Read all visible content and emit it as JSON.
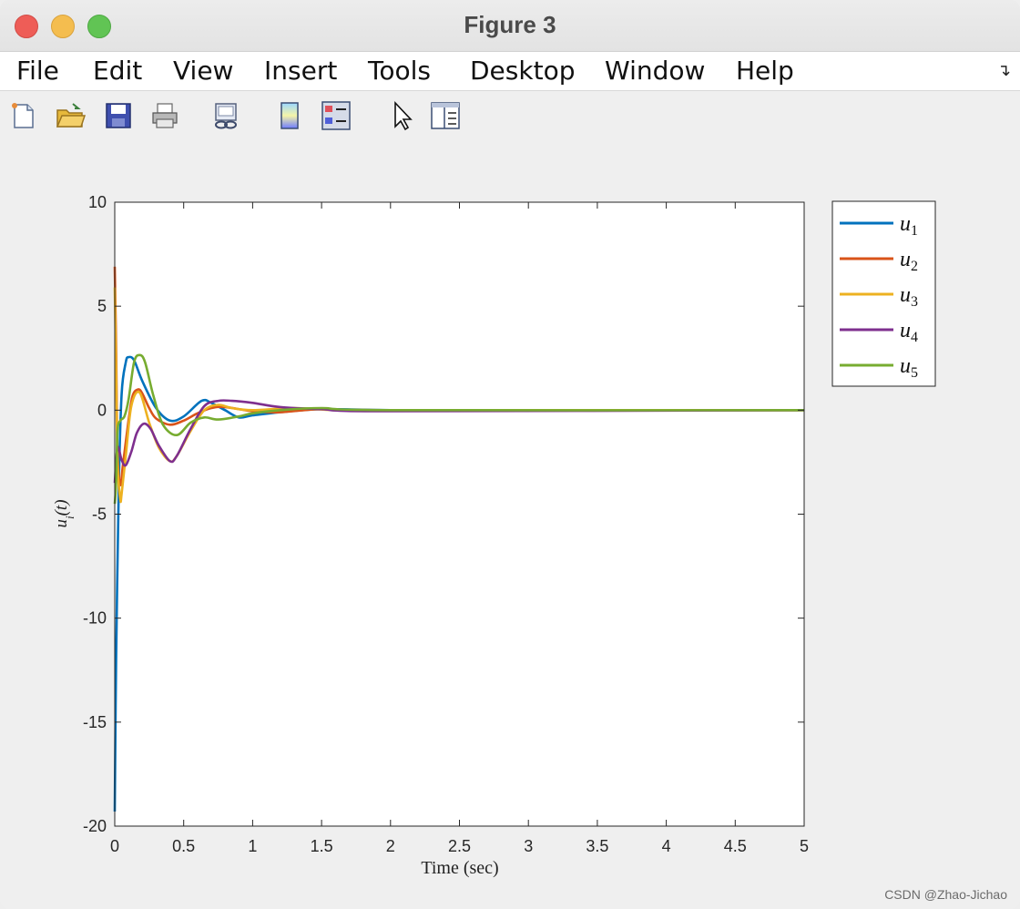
{
  "window": {
    "title": "Figure 3"
  },
  "menu": [
    "File",
    "Edit",
    "View",
    "Insert",
    "Tools",
    "Desktop",
    "Window",
    "Help"
  ],
  "toolbar_icons": [
    "new-figure-icon",
    "open-file-icon",
    "save-icon",
    "print-icon",
    "link-figure-icon",
    "colorbar-icon",
    "legend-icon",
    "pointer-icon",
    "property-inspector-icon"
  ],
  "watermark": "CSDN @Zhao-Jichao",
  "chart_data": {
    "type": "line",
    "title": "",
    "xlabel": "Time (sec)",
    "ylabel": "u_i(t)",
    "xlim": [
      0,
      5
    ],
    "ylim": [
      -20,
      10
    ],
    "xticks": [
      "0",
      "0.5",
      "1",
      "1.5",
      "2",
      "2.5",
      "3",
      "3.5",
      "4",
      "4.5",
      "5"
    ],
    "yticks": [
      "10",
      "5",
      "0",
      "-5",
      "-10",
      "-15",
      "-20"
    ],
    "xtick_values": [
      0,
      0.5,
      1,
      1.5,
      2,
      2.5,
      3,
      3.5,
      4,
      4.5,
      5
    ],
    "ytick_values": [
      10,
      5,
      0,
      -5,
      -10,
      -15,
      -20
    ],
    "grid": false,
    "legend_position": "outside-right-top",
    "series": [
      {
        "name": "u1",
        "color": "#0072BD",
        "x": [
          0,
          0.01,
          0.03,
          0.05,
          0.08,
          0.1,
          0.14,
          0.2,
          0.3,
          0.4,
          0.5,
          0.63,
          0.7,
          0.8,
          0.9,
          1.0,
          1.2,
          1.5,
          2.0,
          3.0,
          5.0
        ],
        "y": [
          -19.3,
          -12,
          -3.5,
          0.8,
          2.3,
          2.55,
          2.4,
          1.4,
          0.1,
          -0.5,
          -0.3,
          0.45,
          0.35,
          0.0,
          -0.35,
          -0.25,
          -0.1,
          0.05,
          0.0,
          0.0,
          0.0
        ]
      },
      {
        "name": "u2",
        "color": "#D95319",
        "x": [
          0,
          0.01,
          0.02,
          0.04,
          0.06,
          0.1,
          0.13,
          0.17,
          0.2,
          0.25,
          0.3,
          0.4,
          0.5,
          0.6,
          0.7,
          0.8,
          1.0,
          1.2,
          1.5,
          2.0,
          5.0
        ],
        "y": [
          6.9,
          3,
          -2,
          -3.6,
          -2.6,
          -0.5,
          0.7,
          1.0,
          0.8,
          0.1,
          -0.4,
          -0.7,
          -0.5,
          -0.15,
          0.1,
          0.15,
          -0.05,
          -0.1,
          0.05,
          0.0,
          0.0
        ]
      },
      {
        "name": "u3",
        "color": "#EDB120",
        "x": [
          0,
          0.01,
          0.02,
          0.04,
          0.05,
          0.08,
          0.12,
          0.18,
          0.25,
          0.32,
          0.4,
          0.45,
          0.55,
          0.65,
          0.75,
          0.85,
          1.0,
          1.3,
          1.6,
          2.0,
          5.0
        ],
        "y": [
          5.9,
          2,
          -2.5,
          -4.3,
          -4.0,
          -2.2,
          0.2,
          0.85,
          -0.6,
          -1.8,
          -2.45,
          -2.2,
          -1.0,
          0.0,
          0.25,
          0.1,
          0.0,
          0.1,
          0.0,
          0.0,
          0.0
        ]
      },
      {
        "name": "u4",
        "color": "#7E2F8E",
        "x": [
          0,
          0.02,
          0.05,
          0.08,
          0.12,
          0.16,
          0.21,
          0.26,
          0.32,
          0.4,
          0.45,
          0.55,
          0.65,
          0.75,
          0.85,
          1.0,
          1.2,
          1.5,
          2.0,
          5.0
        ],
        "y": [
          -3.5,
          -1.8,
          -2.4,
          -2.65,
          -2.0,
          -1.1,
          -0.65,
          -0.9,
          -1.7,
          -2.45,
          -2.2,
          -0.9,
          0.2,
          0.45,
          0.45,
          0.35,
          0.15,
          0.05,
          -0.05,
          0.0
        ]
      },
      {
        "name": "u5",
        "color": "#77AC30",
        "x": [
          0,
          0.01,
          0.02,
          0.04,
          0.07,
          0.1,
          0.14,
          0.18,
          0.22,
          0.28,
          0.35,
          0.45,
          0.55,
          0.65,
          0.75,
          0.9,
          1.0,
          1.2,
          1.5,
          2.0,
          5.0
        ],
        "y": [
          -4.5,
          -3.5,
          -1.0,
          -0.5,
          -0.3,
          0.5,
          2.3,
          2.65,
          2.3,
          0.7,
          -0.7,
          -1.2,
          -0.6,
          -0.35,
          -0.45,
          -0.3,
          -0.15,
          0.0,
          0.1,
          0.0,
          0.0
        ]
      }
    ]
  }
}
